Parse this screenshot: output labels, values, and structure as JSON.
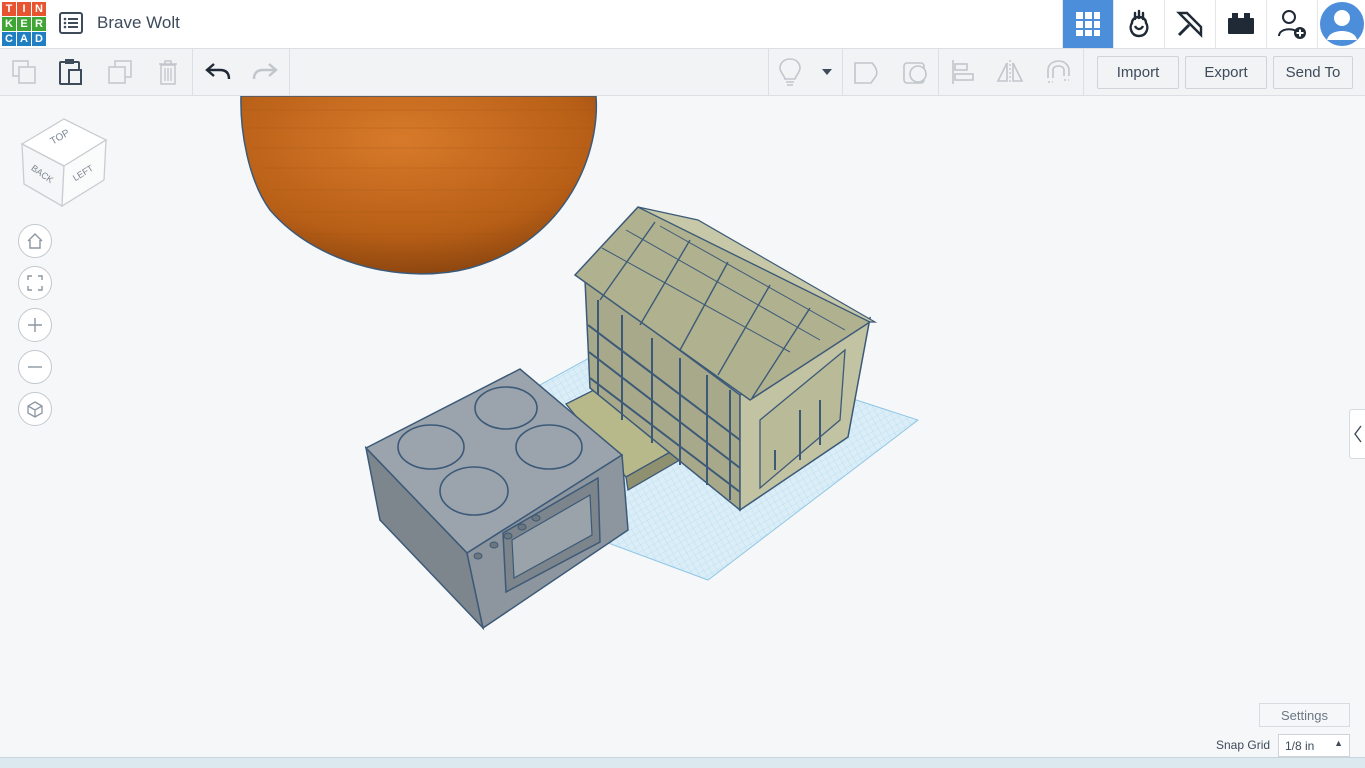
{
  "app": {
    "logo_letters": [
      "T",
      "I",
      "N",
      "K",
      "E",
      "R",
      "C",
      "A",
      "D"
    ],
    "logo_colors": [
      "#e8542f",
      "#e8542f",
      "#e8542f",
      "#3fa535",
      "#3fa535",
      "#3fa535",
      "#1f7fc2",
      "#1f7fc2",
      "#1f7fc2"
    ],
    "project_title": "Brave Wolt",
    "accent": "#4d8edb"
  },
  "topbar": {
    "icons": [
      "3d-design-grid-icon",
      "circuits-icon",
      "minecraft-pickaxe-icon",
      "lego-brick-icon",
      "invite-user-icon",
      "user-avatar-icon"
    ]
  },
  "toolbar": {
    "icons_left": [
      "copy-icon",
      "paste-icon",
      "duplicate-icon",
      "delete-icon",
      "undo-icon",
      "redo-icon"
    ],
    "icons_right": [
      "light-bulb-icon",
      "dropdown-arrow-icon",
      "group-icon",
      "hole-icon",
      "align-icon",
      "mirror-icon",
      "magnet-icon"
    ],
    "import_label": "Import",
    "export_label": "Export",
    "send_to_label": "Send To"
  },
  "viewcube": {
    "top": "TOP",
    "back": "BACK",
    "left": "LEFT"
  },
  "nav_controls": [
    "home-view-icon",
    "fit-view-icon",
    "zoom-in-icon",
    "zoom-out-icon",
    "perspective-icon"
  ],
  "footer": {
    "settings_label": "Settings",
    "snap_grid_label": "Snap Grid",
    "snap_grid_value": "1/8 in"
  }
}
